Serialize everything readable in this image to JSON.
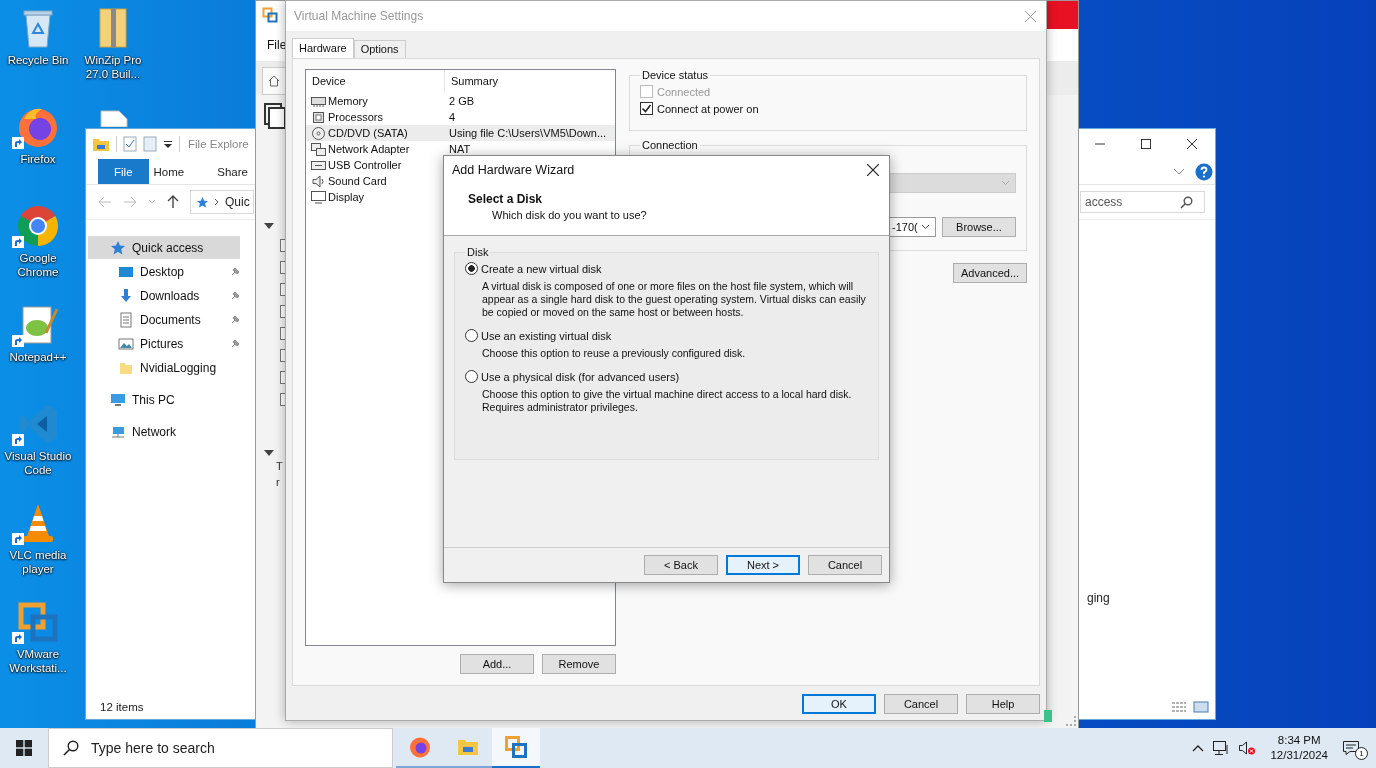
{
  "desktop_icons": [
    {
      "kind": "recycle",
      "label": "Recycle Bin",
      "shortcut": false
    },
    {
      "kind": "firefox",
      "label": "Firefox",
      "shortcut": true
    },
    {
      "kind": "chrome",
      "label": "Google Chrome",
      "shortcut": true
    },
    {
      "kind": "notepad",
      "label": "Notepad++",
      "shortcut": true
    },
    {
      "kind": "vscode",
      "label": "Visual Studio Code",
      "shortcut": true
    },
    {
      "kind": "vlc",
      "label": "VLC media player",
      "shortcut": true
    },
    {
      "kind": "vmware",
      "label": "VMware Workstati...",
      "shortcut": true
    }
  ],
  "desktop_icons_second_column": [
    {
      "kind": "zip",
      "label": "WinZip Pro 27.0 Buil...",
      "shortcut": false
    }
  ],
  "file_explorer": {
    "title": "File Explore",
    "ribbon_tabs": [
      {
        "label": "File",
        "selected": true
      },
      {
        "label": "Home",
        "selected": false
      },
      {
        "label": "Share",
        "selected": false
      }
    ],
    "address": "Quic",
    "search": {
      "placeholder": "access"
    },
    "nav": [
      {
        "kind": "star",
        "label": "Quick access",
        "selected": true,
        "pinned": false,
        "children": [
          {
            "kind": "desktop",
            "label": "Desktop",
            "selected": false,
            "pinned": true
          },
          {
            "kind": "download",
            "label": "Downloads",
            "selected": false,
            "pinned": true
          },
          {
            "kind": "documents",
            "label": "Documents",
            "selected": false,
            "pinned": true
          },
          {
            "kind": "pictures",
            "label": "Pictures",
            "selected": false,
            "pinned": true
          },
          {
            "kind": "folder",
            "label": "NvidiaLogging",
            "selected": false,
            "pinned": false
          }
        ]
      },
      {
        "kind": "pc",
        "label": "This PC",
        "selected": false,
        "pinned": false
      },
      {
        "kind": "network",
        "label": "Network",
        "selected": false,
        "pinned": false
      }
    ],
    "content_fragment": "ging",
    "status": "12 items"
  },
  "vmware_window": {
    "menu": "File",
    "tree_fragments": [
      "T",
      "r"
    ]
  },
  "settings": {
    "title": "Virtual Machine Settings",
    "tabs": [
      {
        "label": "Hardware",
        "selected": true
      },
      {
        "label": "Options",
        "selected": false
      }
    ],
    "columns": [
      "Device",
      "Summary"
    ],
    "devices": [
      {
        "kind": "memory",
        "name": "Memory",
        "summary": "2 GB",
        "selected": false
      },
      {
        "kind": "processor",
        "name": "Processors",
        "summary": "4",
        "selected": false
      },
      {
        "kind": "cdrom",
        "name": "CD/DVD (SATA)",
        "summary": "Using file C:\\Users\\VM5\\Down...",
        "selected": true
      },
      {
        "kind": "network",
        "name": "Network Adapter",
        "summary": "NAT",
        "selected": false
      },
      {
        "kind": "usb",
        "name": "USB Controller",
        "selected": false
      },
      {
        "kind": "sound",
        "name": "Sound Card",
        "selected": false
      },
      {
        "kind": "display",
        "name": "Display",
        "selected": false
      }
    ],
    "list_buttons": [
      "Add...",
      "Remove"
    ],
    "device_status": {
      "title": "Device status",
      "options": [
        {
          "label": "Connected",
          "checked": false,
          "disabled": true
        },
        {
          "label": "Connect at power on",
          "checked": true,
          "disabled": false
        }
      ]
    },
    "connection": {
      "title": "Connection",
      "image_value": "-170(",
      "browse": "Browse..."
    },
    "advanced": "Advanced...",
    "buttons": [
      {
        "label": "OK",
        "default": true
      },
      {
        "label": "Cancel",
        "default": false
      },
      {
        "label": "Help",
        "default": false
      }
    ]
  },
  "wizard": {
    "title": "Add Hardware Wizard",
    "heading": "Select a Disk",
    "subheading": "Which disk do you want to use?",
    "group": "Disk",
    "options": [
      {
        "label": "Create a new virtual disk",
        "description": "A virtual disk is composed of one or more files on the host file system, which will appear as a single hard disk to the guest operating system. Virtual disks can easily be copied or moved on the same host or between hosts.",
        "selected": true
      },
      {
        "label": "Use an existing virtual disk",
        "description": "Choose this option to reuse a previously configured disk.",
        "selected": false
      },
      {
        "label": "Use a physical disk (for advanced users)",
        "description": "Choose this option to give the virtual machine direct access to a local hard disk. Requires administrator privileges.",
        "selected": false
      }
    ],
    "buttons": [
      {
        "label": "< Back",
        "default": false
      },
      {
        "label": "Next >",
        "default": true
      },
      {
        "label": "Cancel",
        "default": false
      }
    ]
  },
  "taskbar": {
    "search_placeholder": "Type here to search",
    "apps": [
      {
        "kind": "firefox",
        "selected": false
      },
      {
        "kind": "explorer",
        "selected": false
      },
      {
        "kind": "vmware",
        "selected": true
      }
    ],
    "muted": true,
    "time": "8:34 PM",
    "date": "12/31/2024",
    "notifications": "1"
  }
}
